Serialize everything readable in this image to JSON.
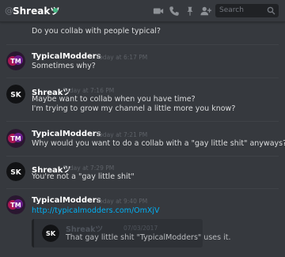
{
  "header": {
    "at_symbol": "@",
    "username": "Shreakツ",
    "status_color": "#43b581",
    "icons": [
      "video-icon",
      "phone-icon",
      "pin-icon",
      "add-friend-icon"
    ],
    "search_placeholder": "Search"
  },
  "messages": [
    {
      "lines": [
        "Do you collab with people typical?"
      ]
    },
    {
      "author": "TypicalModders",
      "timestamp": "Today at 6:17 PM",
      "avatar": "typicalmodders-avatar",
      "lines": [
        "Sometimes why?"
      ]
    },
    {
      "author": "Shreakツ",
      "timestamp": "Today at 7:16 PM",
      "avatar": "shreak-avatar",
      "lines": [
        "Maybe want to collab when you have time?",
        "I'm trying to grow my channel a little more you know?"
      ]
    },
    {
      "author": "TypicalModders",
      "timestamp": "Today at 7:21 PM",
      "avatar": "typicalmodders-avatar",
      "lines": [
        "Why would you want to do a collab with a \"gay little shit\" anyways?"
      ]
    },
    {
      "author": "Shreakツ",
      "timestamp": "Today at 7:29 PM",
      "avatar": "shreak-avatar",
      "lines": [
        "You're not a \"gay little shit\""
      ]
    },
    {
      "author": "TypicalModders",
      "timestamp": "Today at 9:40 PM",
      "avatar": "typicalmodders-avatar",
      "link": "http://typicalmodders.com/OmXjV",
      "embed": {
        "author": "Shreakツ",
        "date": "07/03/2017",
        "text": "That gay little shit \"TypicalModders\" uses it."
      }
    }
  ]
}
